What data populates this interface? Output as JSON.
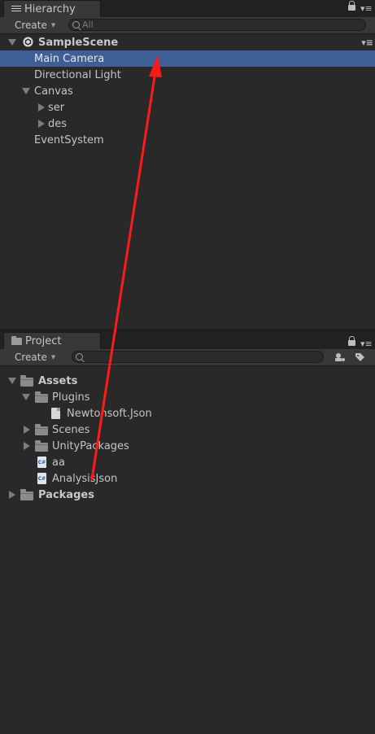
{
  "hierarchy": {
    "tab_label": "Hierarchy",
    "create_label": "Create",
    "search_placeholder": "All",
    "scene": "SampleScene",
    "items": [
      {
        "label": "Main Camera",
        "selected": true
      },
      {
        "label": "Directional Light"
      },
      {
        "label": "Canvas",
        "expanded": true
      },
      {
        "label": "ser",
        "collapsed": true
      },
      {
        "label": "des",
        "collapsed": true
      },
      {
        "label": "EventSystem"
      }
    ]
  },
  "project": {
    "tab_label": "Project",
    "create_label": "Create",
    "search_value": "",
    "tree": [
      {
        "label": "Assets",
        "bold": true
      },
      {
        "label": "Plugins"
      },
      {
        "label": "Newtonsoft.Json",
        "icon": "file-icon"
      },
      {
        "label": "Scenes"
      },
      {
        "label": "UnityPackages"
      },
      {
        "label": "aa",
        "icon": "csharp-script-icon"
      },
      {
        "label": "AnalysisJson",
        "icon": "csharp-script-icon"
      },
      {
        "label": "Packages",
        "bold": true
      }
    ],
    "cs_icon_text": "C#"
  },
  "annotation": {
    "color": "#ff1a1a",
    "description_icon": "red-arrow"
  }
}
